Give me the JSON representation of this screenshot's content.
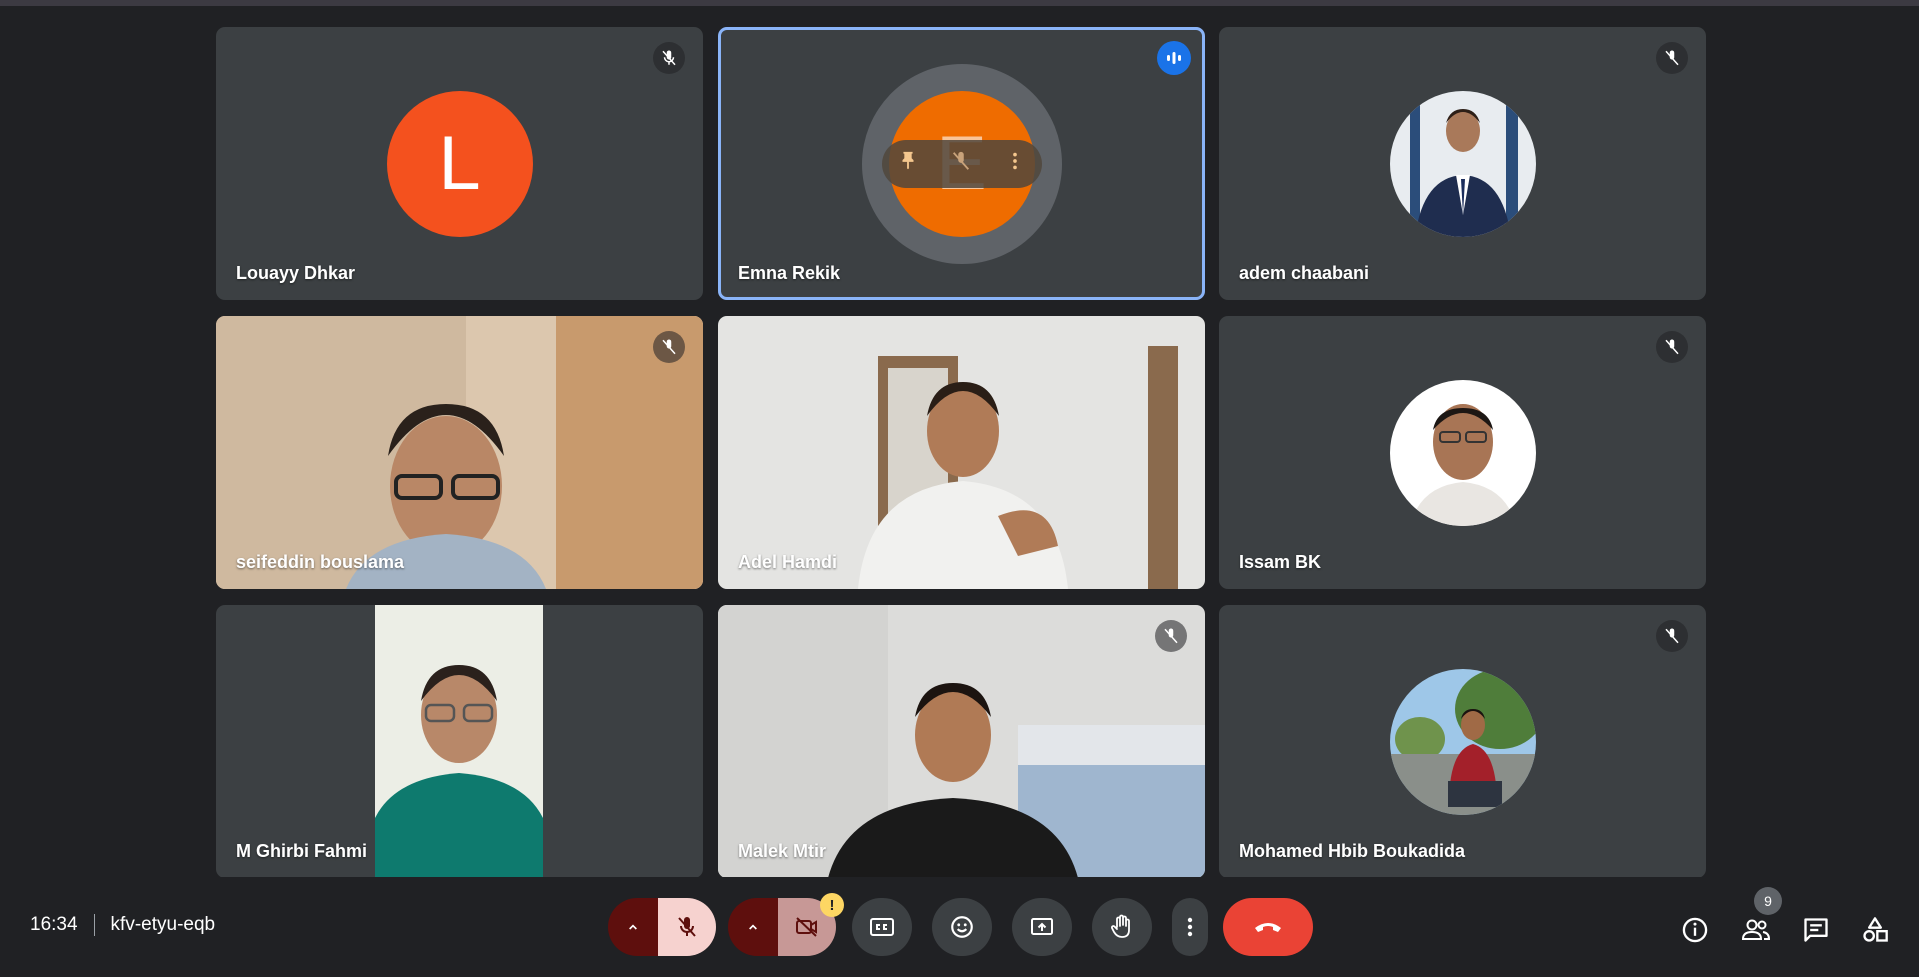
{
  "meeting": {
    "time": "16:34",
    "code": "kfv-etyu-eqb"
  },
  "participants": [
    {
      "name": "Louayy Dhkar",
      "avatar_letter": "L",
      "muted": true
    },
    {
      "name": "Emna Rekik",
      "avatar_letter": "E",
      "speaking": true
    },
    {
      "name": "adem chaabani",
      "muted": true
    },
    {
      "name": "seifeddin bouslama",
      "muted": true
    },
    {
      "name": "Adel Hamdi"
    },
    {
      "name": "Issam BK",
      "muted": true
    },
    {
      "name": "M Ghirbi Fahmi"
    },
    {
      "name": "Malek Mtir",
      "muted": true
    },
    {
      "name": "Mohamed Hbib Boukadida",
      "muted": true
    }
  ],
  "controls": {
    "people_count": "9",
    "camera_warning": "!"
  },
  "icons": {
    "mute": "mic-off-icon",
    "speaking": "audio-level-icon",
    "pin": "pin-icon",
    "more": "more-vert-icon",
    "captions": "closed-captions-icon",
    "emoji": "emoji-icon",
    "present": "present-screen-icon",
    "hand": "raise-hand-icon",
    "end": "end-call-icon",
    "info": "info-icon",
    "people": "people-icon",
    "chat": "chat-icon",
    "activities": "activities-icon"
  },
  "colors": {
    "background": "#202124",
    "tile": "#3c4043",
    "active_outline": "#8ab4f8",
    "avatar_louayy": "#f4511e",
    "avatar_emna": "#ef6c00",
    "end_call": "#ea4335",
    "mic_off_bg": "#f6d2cf",
    "cam_off_bg": "#c79896",
    "split_dark": "#5e0f0d"
  }
}
